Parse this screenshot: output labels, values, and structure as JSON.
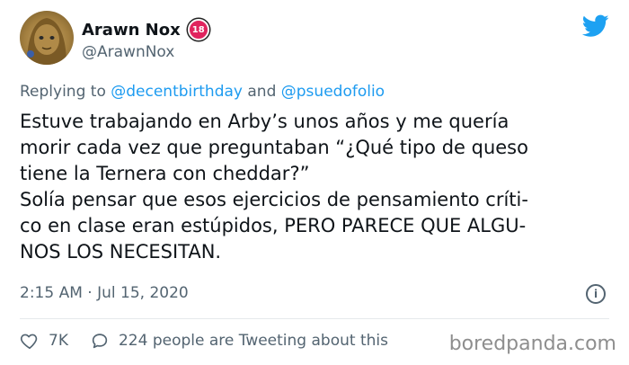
{
  "user": {
    "display_name": "Arawn Nox",
    "badge": "18",
    "handle": "@ArawnNox"
  },
  "reply": {
    "prefix": "Replying to ",
    "mention1": "@decentbirthday",
    "joiner": " and ",
    "mention2": "@psuedofolio"
  },
  "tweet": {
    "lines": [
      "Estuve trabajando en Arby’s unos años y me quería",
      "morir cada vez que preguntaban “¿Qué tipo de queso",
      "tiene la Ternera con cheddar?”",
      "Solía pensar que esos ejercicios de pensamiento críti-",
      "co en clase eran estúpidos, PERO PARECE QUE ALGU-",
      "NOS LOS NECESITAN."
    ]
  },
  "meta": {
    "timestamp": "2:15 AM · Jul 15, 2020"
  },
  "actions": {
    "likes": "7K",
    "tweeting": "224 people are Tweeting about this"
  },
  "watermark": "boredpanda.com",
  "colors": {
    "link": "#1d9bf0",
    "muted": "#536471",
    "twitter_blue": "#1da1f2",
    "badge": "#e0245e"
  }
}
